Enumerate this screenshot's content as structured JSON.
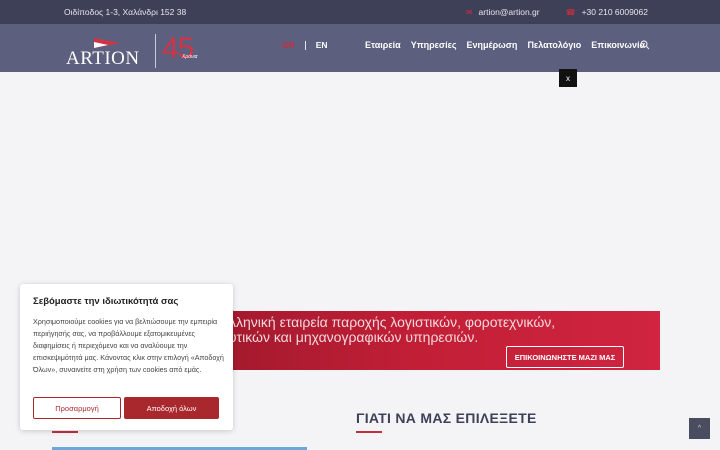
{
  "topbar": {
    "address": "Οιδίποδος 1-3, Χαλάνδρι 152 38",
    "email_icon": "envelope-icon",
    "email": "artion@artion.gr",
    "phone_icon": "phone-icon",
    "phone": "+30 210 6009062"
  },
  "header": {
    "logo_text": "ARTION",
    "anniversary_number": "45",
    "anniversary_script": "Χρόνια",
    "languages": {
      "gr": "GR",
      "en": "EN"
    },
    "nav": [
      "Εταιρεία",
      "Υπηρεσίες",
      "Ενημέρωση",
      "Πελατολόγιο",
      "Επικοινωνία"
    ],
    "search_icon": "search-icon"
  },
  "overlay": {
    "close_label": "x"
  },
  "banner": {
    "line1": "η Ελληνική εταιρεία παροχής λογιστικών, φοροτεχνικών,",
    "line2": "υλευτικών και μηχανογραφικών υπηρεσιών.",
    "cta": "ΕΠΙΚΟΙΝΩΝΗΣΤΕ ΜΑΖΙ ΜΑΣ"
  },
  "why": {
    "title": "ΓΙΑΤΙ ΝΑ ΜΑΣ ΕΠΙΛΕΞΕΤΕ"
  },
  "scroll_top": {
    "icon": "chevron-up-icon",
    "label": "^"
  },
  "cookie": {
    "title": "Σεβόμαστε την ιδιωτικότητά σας",
    "body": "Χρησιμοποιούμε cookies για να βελτιώσουμε την εμπειρία περιήγησής σας, να προβάλλουμε εξατομικευμένες διαφημίσεις ή περιεχόμενο και να αναλύουμε την επισκεψιμότητά μας. Κάνοντας κλικ στην επιλογή «Αποδοχή Όλων», συναινείτε στη χρήση των cookies από εμάς.",
    "customize": "Προσαρμογή",
    "accept": "Αποδοχή όλων"
  },
  "colors": {
    "topbar": "#3e4058",
    "header": "#5c5f7d",
    "accent": "#c62d3f",
    "cookie_button": "#a9282d"
  }
}
